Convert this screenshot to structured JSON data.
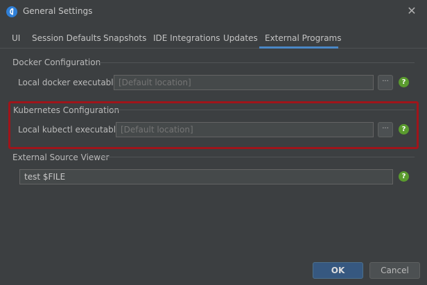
{
  "window": {
    "title": "General Settings",
    "close_glyph": "✕"
  },
  "tabs": [
    {
      "label": "UI"
    },
    {
      "label": "Session Defaults"
    },
    {
      "label": "Snapshots"
    },
    {
      "label": "IDE Integrations"
    },
    {
      "label": "Updates"
    },
    {
      "label": "External Programs",
      "active": true
    }
  ],
  "docker": {
    "section_title": "Docker Configuration",
    "label": "Local docker executable:",
    "placeholder": "[Default location]",
    "browse_label": "···",
    "help_label": "?"
  },
  "kubernetes": {
    "section_title": "Kubernetes Configuration",
    "label": "Local kubectl executable:",
    "placeholder": "[Default location]",
    "browse_label": "···",
    "help_label": "?"
  },
  "source_viewer": {
    "section_title": "External Source Viewer",
    "value": "test $FILE",
    "help_label": "?"
  },
  "buttons": {
    "ok": "OK",
    "cancel": "Cancel"
  },
  "colors": {
    "background": "#3c3f41",
    "accent": "#4a88c7",
    "highlight": "#a0141a",
    "help": "#5a9b2e"
  }
}
